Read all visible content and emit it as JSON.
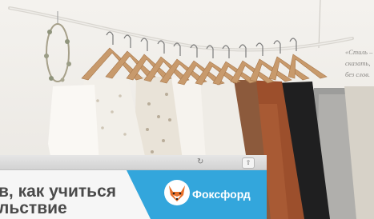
{
  "quote": {
    "lines": [
      "«Стиль –",
      "сказать,",
      "без слов."
    ]
  },
  "laptop": {
    "reload_glyph": "↻",
    "share_glyph": "⇧",
    "headline_line1": "в, как учиться",
    "headline_line2": "льствие",
    "brand_name": "Фоксфорд",
    "brand_color": "#33a6dc",
    "logo_icon": "fox-logo-icon"
  },
  "colors": {
    "wall": "#f1efeb",
    "rail": "#d8d6d2",
    "hanger_wood": "#c89a6c"
  }
}
